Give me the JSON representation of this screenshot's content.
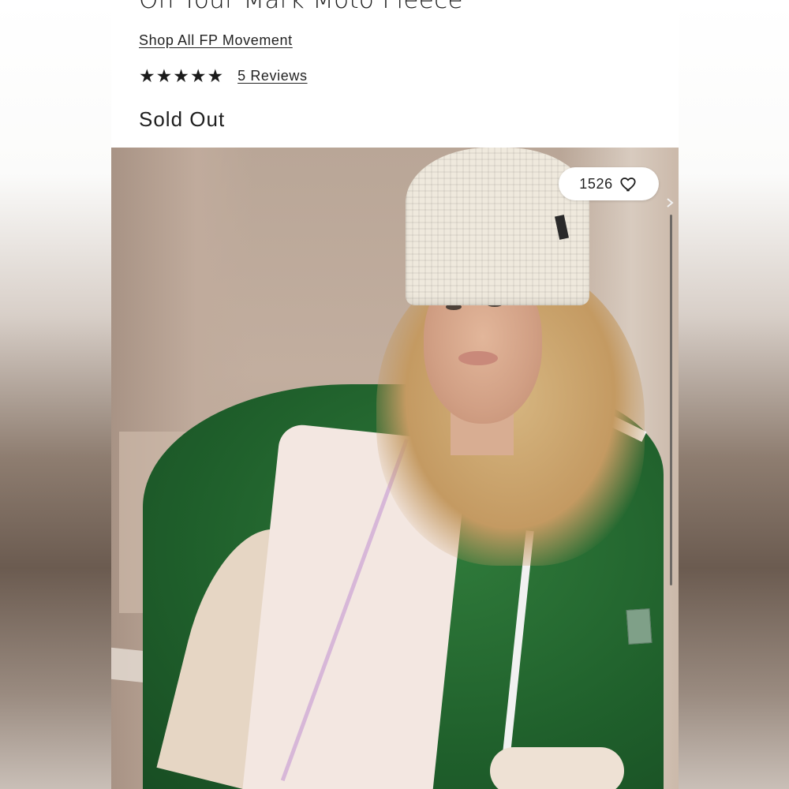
{
  "product": {
    "title": "On Your Mark Moto Fleece",
    "shop_link": "Shop All FP Movement",
    "rating": {
      "stars": 5,
      "max": 5,
      "reviews_label": "5 Reviews"
    },
    "status": "Sold Out"
  },
  "gallery": {
    "like_count": "1526",
    "like_icon": "heart-outline-icon"
  },
  "colors": {
    "jacket_green": "#1f5f2b",
    "text": "#1b1b1b"
  }
}
